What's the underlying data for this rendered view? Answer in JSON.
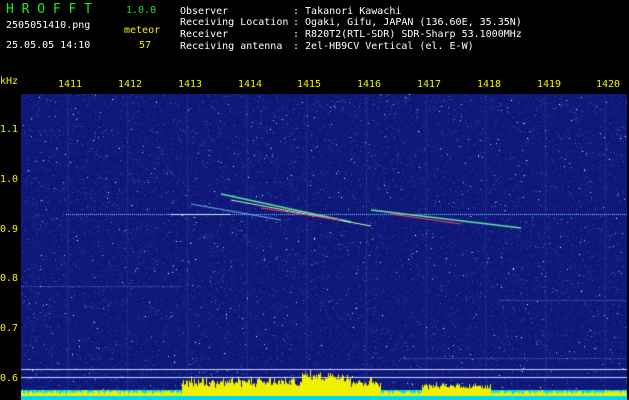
{
  "app": {
    "logo": "HROFFT",
    "version": "1.0.0"
  },
  "file": {
    "name": "2505051410.png",
    "datetime": "25.05.05 14:10"
  },
  "detection": {
    "label": "meteor",
    "count": "57"
  },
  "info": [
    {
      "key": "Observer",
      "value": ": Takanori Kawachi"
    },
    {
      "key": "Receiving Location",
      "value": ": Ogaki, Gifu, JAPAN (136.60E, 35.35N)"
    },
    {
      "key": "Receiver",
      "value": ": R820T2(RTL-SDR) SDR-Sharp 53.1000MHz"
    },
    {
      "key": "Receiving antenna",
      "value": ": 2el-HB9CV Vertical (el. E-W)"
    }
  ],
  "axes": {
    "unit": "kHz",
    "x_ticks": [
      "1411",
      "1412",
      "1413",
      "1414",
      "1415",
      "1416",
      "1417",
      "1418",
      "1419",
      "1420"
    ],
    "y_ticks": [
      "1.1",
      "1.0",
      "0.9",
      "0.8",
      "0.7",
      "0.6"
    ]
  },
  "colors": {
    "background": "#0f1878",
    "axis_text": "#f3f300",
    "logo": "#22e81a",
    "label_text": "#ffffff",
    "level_bar": "#f0f000",
    "baseline": "#00d8f0"
  }
}
